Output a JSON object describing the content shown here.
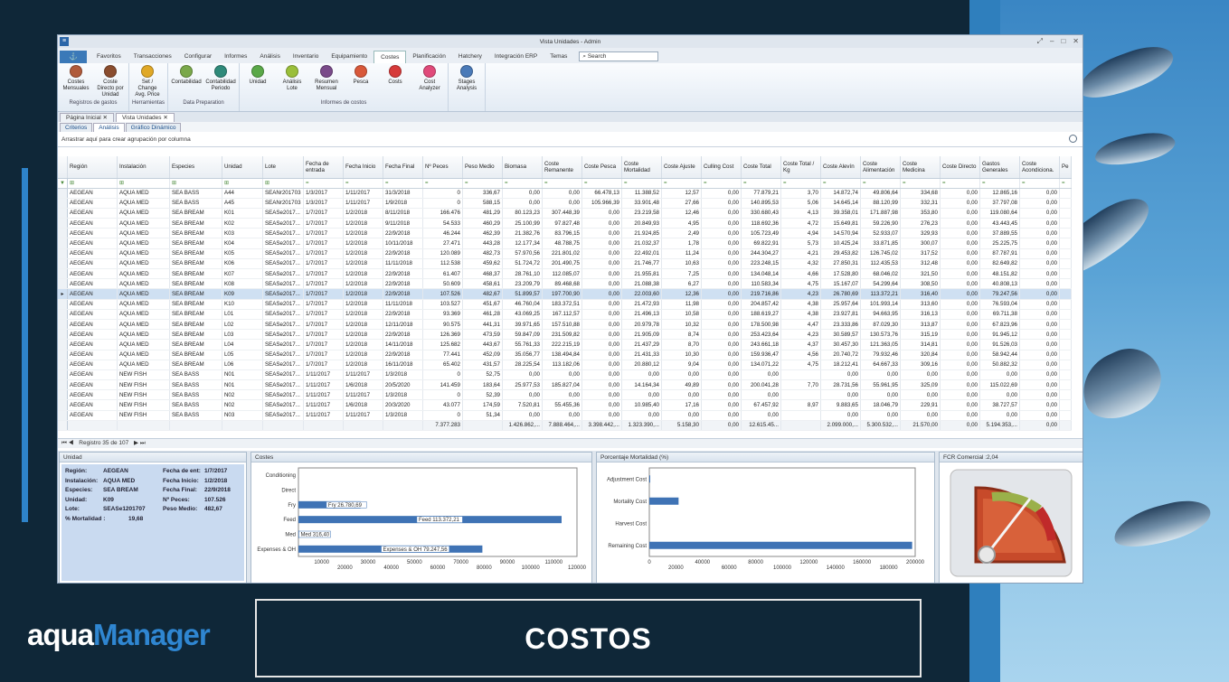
{
  "window": {
    "title": "Vista Unidades - Admin"
  },
  "menu": {
    "tabs": [
      "Favoritos",
      "Transacciones",
      "Configurar",
      "Informes",
      "Análisis",
      "Inventario",
      "Equipamiento",
      "Costes",
      "Planificación",
      "Hatchery",
      "Integración ERP",
      "Temas"
    ],
    "active": "Costes",
    "search_placeholder": "Search"
  },
  "ribbon": {
    "groups": [
      {
        "label": "Registros de gastos",
        "buttons": [
          {
            "label": "Costes Mensuales",
            "color": "#b05a3a"
          },
          {
            "label": "Coste Directo por Unidad",
            "color": "#8a4d2e"
          }
        ]
      },
      {
        "label": "Herramientas",
        "buttons": [
          {
            "label": "Set / Change Avg. Price",
            "color": "#e0a826"
          }
        ]
      },
      {
        "label": "Data Preparation",
        "buttons": [
          {
            "label": "Contabilidad",
            "color": "#7aa84a"
          },
          {
            "label": "Contabilidad Periodo",
            "color": "#2f8a7a"
          }
        ]
      },
      {
        "label": "Informes de costos",
        "buttons": [
          {
            "label": "Unidad",
            "color": "#5aa848"
          },
          {
            "label": "Análisis Lote",
            "color": "#9abf3a"
          },
          {
            "label": "Resumen Mensual",
            "color": "#7a4a8a"
          },
          {
            "label": "Pesca",
            "color": "#d8583a"
          },
          {
            "label": "Costs",
            "color": "#d63a3a"
          },
          {
            "label": "Cost Analyzer",
            "color": "#e04a7a"
          }
        ]
      },
      {
        "label": "",
        "buttons": [
          {
            "label": "Stages Analysis",
            "color": "#4a7ab8"
          }
        ]
      }
    ]
  },
  "doc_tabs": [
    "Página Inicial",
    "Vista Unidades"
  ],
  "sub_tabs": [
    "Criterios",
    "Análisis",
    "Gráfico Dinámico"
  ],
  "group_hint": "Arrastrar aquí para crear agrupación por columna",
  "grid": {
    "columns": [
      "Región",
      "Instalación",
      "Especies",
      "Unidad",
      "Lote",
      "Fecha de entrada",
      "Fecha Inicio",
      "Fecha Final",
      "Nº Peces",
      "Peso Medio",
      "Biomasa",
      "Coste Remanente",
      "Coste Pesca",
      "Coste Mortalidad",
      "Coste Ajuste",
      "Culling Cost",
      "Coste Total",
      "Coste Total / Kg",
      "Coste Alevín",
      "Coste Alimentación",
      "Coste Medicina",
      "Coste Directo",
      "Gastos Generales",
      "Coste Acondiciona.",
      "Pe"
    ],
    "rows": [
      [
        "AEGEAN",
        "AQUA MED",
        "SEA BASS",
        "A44",
        "SEANr201703",
        "1/3/2017",
        "1/11/2017",
        "31/3/2018",
        "0",
        "336,67",
        "0,00",
        "0,00",
        "66.478,13",
        "11.388,52",
        "12,57",
        "0,00",
        "77.879,21",
        "3,70",
        "14.872,74",
        "49.806,64",
        "334,68",
        "0,00",
        "12.865,16",
        "0,00"
      ],
      [
        "AEGEAN",
        "AQUA MED",
        "SEA BASS",
        "A45",
        "SEANr201703",
        "1/3/2017",
        "1/11/2017",
        "1/9/2018",
        "0",
        "588,15",
        "0,00",
        "0,00",
        "105.966,39",
        "33.901,48",
        "27,66",
        "0,00",
        "140.895,53",
        "5,06",
        "14.645,14",
        "88.120,99",
        "332,31",
        "0,00",
        "37.797,08",
        "0,00"
      ],
      [
        "AEGEAN",
        "AQUA MED",
        "SEA BREAM",
        "K01",
        "SEASe2017...",
        "1/7/2017",
        "1/2/2018",
        "8/11/2018",
        "166.476",
        "481,29",
        "80.123,23",
        "307.448,39",
        "0,00",
        "23.219,58",
        "12,46",
        "0,00",
        "330.680,43",
        "4,13",
        "39.358,01",
        "171.887,98",
        "353,80",
        "0,00",
        "119.080,64",
        "0,00"
      ],
      [
        "AEGEAN",
        "AQUA MED",
        "SEA BREAM",
        "K02",
        "SEASe2017...",
        "1/7/2017",
        "1/2/2018",
        "9/11/2018",
        "54.533",
        "460,29",
        "25.100,99",
        "97.827,48",
        "0,00",
        "20.849,93",
        "4,95",
        "0,00",
        "118.692,36",
        "4,72",
        "15.649,81",
        "59.226,90",
        "276,23",
        "0,00",
        "43.443,45",
        "0,00"
      ],
      [
        "AEGEAN",
        "AQUA MED",
        "SEA BREAM",
        "K03",
        "SEASe2017...",
        "1/7/2017",
        "1/2/2018",
        "22/9/2018",
        "46.244",
        "462,39",
        "21.382,76",
        "83.796,15",
        "0,00",
        "21.924,85",
        "2,49",
        "0,00",
        "105.723,49",
        "4,94",
        "14.570,94",
        "52.933,07",
        "329,93",
        "0,00",
        "37.889,55",
        "0,00"
      ],
      [
        "AEGEAN",
        "AQUA MED",
        "SEA BREAM",
        "K04",
        "SEASe2017...",
        "1/7/2017",
        "1/2/2018",
        "10/11/2018",
        "27.471",
        "443,28",
        "12.177,34",
        "48.788,75",
        "0,00",
        "21.032,37",
        "1,78",
        "0,00",
        "69.822,91",
        "5,73",
        "10.425,24",
        "33.871,85",
        "300,07",
        "0,00",
        "25.225,75",
        "0,00"
      ],
      [
        "AEGEAN",
        "AQUA MED",
        "SEA BREAM",
        "K05",
        "SEASe2017...",
        "1/7/2017",
        "1/2/2018",
        "22/9/2018",
        "120.089",
        "482,73",
        "57.970,56",
        "221.801,02",
        "0,00",
        "22.492,01",
        "11,24",
        "0,00",
        "244.304,27",
        "4,21",
        "29.453,82",
        "126.745,02",
        "317,52",
        "0,00",
        "87.787,91",
        "0,00"
      ],
      [
        "AEGEAN",
        "AQUA MED",
        "SEA BREAM",
        "K06",
        "SEASe2017...",
        "1/7/2017",
        "1/2/2018",
        "11/11/2018",
        "112.538",
        "459,62",
        "51.724,72",
        "201.490,75",
        "0,00",
        "21.746,77",
        "10,63",
        "0,00",
        "223.248,15",
        "4,32",
        "27.850,31",
        "112.435,53",
        "312,48",
        "0,00",
        "82.649,82",
        "0,00"
      ],
      [
        "AEGEAN",
        "AQUA MED",
        "SEA BREAM",
        "K07",
        "SEASe2017...",
        "1/7/2017",
        "1/2/2018",
        "22/9/2018",
        "61.407",
        "468,37",
        "28.761,10",
        "112.085,07",
        "0,00",
        "21.955,81",
        "7,25",
        "0,00",
        "134.048,14",
        "4,66",
        "17.528,80",
        "68.046,02",
        "321,50",
        "0,00",
        "48.151,82",
        "0,00"
      ],
      [
        "AEGEAN",
        "AQUA MED",
        "SEA BREAM",
        "K08",
        "SEASe2017...",
        "1/7/2017",
        "1/2/2018",
        "22/9/2018",
        "50.609",
        "458,61",
        "23.209,79",
        "89.468,68",
        "0,00",
        "21.088,38",
        "6,27",
        "0,00",
        "110.583,34",
        "4,75",
        "15.167,07",
        "54.299,64",
        "308,50",
        "0,00",
        "40.808,13",
        "0,00"
      ],
      [
        "AEGEAN",
        "AQUA MED",
        "SEA BREAM",
        "K09",
        "SEASe2017...",
        "1/7/2017",
        "1/2/2018",
        "22/9/2018",
        "107.526",
        "482,67",
        "51.899,57",
        "197.700,90",
        "0,00",
        "22.003,60",
        "12,36",
        "0,00",
        "219.716,86",
        "4,23",
        "26.780,69",
        "113.372,21",
        "316,40",
        "0,00",
        "79.247,56",
        "0,00"
      ],
      [
        "AEGEAN",
        "AQUA MED",
        "SEA BREAM",
        "K10",
        "SEASe2017...",
        "1/7/2017",
        "1/2/2018",
        "11/11/2018",
        "103.527",
        "451,67",
        "46.760,04",
        "183.372,51",
        "0,00",
        "21.472,93",
        "11,98",
        "0,00",
        "204.857,42",
        "4,38",
        "25.957,64",
        "101.993,14",
        "313,60",
        "0,00",
        "76.593,04",
        "0,00"
      ],
      [
        "AEGEAN",
        "AQUA MED",
        "SEA BREAM",
        "L01",
        "SEASe2017...",
        "1/7/2017",
        "1/2/2018",
        "22/9/2018",
        "93.369",
        "461,28",
        "43.069,25",
        "167.112,57",
        "0,00",
        "21.496,13",
        "10,58",
        "0,00",
        "188.619,27",
        "4,38",
        "23.927,81",
        "94.663,95",
        "316,13",
        "0,00",
        "69.711,38",
        "0,00"
      ],
      [
        "AEGEAN",
        "AQUA MED",
        "SEA BREAM",
        "L02",
        "SEASe2017...",
        "1/7/2017",
        "1/2/2018",
        "12/11/2018",
        "90.575",
        "441,31",
        "39.971,65",
        "157.510,88",
        "0,00",
        "20.979,78",
        "10,32",
        "0,00",
        "178.500,98",
        "4,47",
        "23.333,86",
        "87.029,30",
        "313,87",
        "0,00",
        "67.823,96",
        "0,00"
      ],
      [
        "AEGEAN",
        "AQUA MED",
        "SEA BREAM",
        "L03",
        "SEASe2017...",
        "1/7/2017",
        "1/2/2018",
        "22/9/2018",
        "126.369",
        "473,59",
        "59.847,09",
        "231.509,82",
        "0,00",
        "21.905,09",
        "8,74",
        "0,00",
        "253.423,64",
        "4,23",
        "30.589,57",
        "130.573,76",
        "315,19",
        "0,00",
        "91.945,12",
        "0,00"
      ],
      [
        "AEGEAN",
        "AQUA MED",
        "SEA BREAM",
        "L04",
        "SEASe2017...",
        "1/7/2017",
        "1/2/2018",
        "14/11/2018",
        "125.682",
        "443,67",
        "55.761,33",
        "222.215,19",
        "0,00",
        "21.437,29",
        "8,70",
        "0,00",
        "243.661,18",
        "4,37",
        "30.457,30",
        "121.363,05",
        "314,81",
        "0,00",
        "91.526,03",
        "0,00"
      ],
      [
        "AEGEAN",
        "AQUA MED",
        "SEA BREAM",
        "L05",
        "SEASe2017...",
        "1/7/2017",
        "1/2/2018",
        "22/9/2018",
        "77.441",
        "452,09",
        "35.056,77",
        "138.494,84",
        "0,00",
        "21.431,33",
        "10,30",
        "0,00",
        "159.936,47",
        "4,56",
        "20.740,72",
        "79.932,46",
        "320,84",
        "0,00",
        "58.942,44",
        "0,00"
      ],
      [
        "AEGEAN",
        "AQUA MED",
        "SEA BREAM",
        "L06",
        "SEASe2017...",
        "1/7/2017",
        "1/2/2018",
        "16/11/2018",
        "65.402",
        "431,57",
        "28.225,54",
        "113.182,06",
        "0,00",
        "20.880,12",
        "9,04",
        "0,00",
        "134.071,22",
        "4,75",
        "18.212,41",
        "64.667,33",
        "309,16",
        "0,00",
        "50.882,32",
        "0,00"
      ],
      [
        "AEGEAN",
        "NEW FISH",
        "SEA BASS",
        "N01",
        "SEASe2017...",
        "1/11/2017",
        "1/11/2017",
        "1/3/2018",
        "0",
        "52,75",
        "0,00",
        "0,00",
        "0,00",
        "0,00",
        "0,00",
        "0,00",
        "0,00",
        "",
        "0,00",
        "0,00",
        "0,00",
        "0,00",
        "0,00",
        "0,00"
      ],
      [
        "AEGEAN",
        "NEW FISH",
        "SEA BASS",
        "N01",
        "SEASe2017...",
        "1/11/2017",
        "1/6/2018",
        "20/5/2020",
        "141.459",
        "183,64",
        "25.977,53",
        "185.827,04",
        "0,00",
        "14.164,34",
        "49,89",
        "0,00",
        "200.041,28",
        "7,70",
        "28.731,56",
        "55.961,95",
        "325,09",
        "0,00",
        "115.022,69",
        "0,00"
      ],
      [
        "AEGEAN",
        "NEW FISH",
        "SEA BASS",
        "N02",
        "SEASe2017...",
        "1/11/2017",
        "1/11/2017",
        "1/3/2018",
        "0",
        "52,39",
        "0,00",
        "0,00",
        "0,00",
        "0,00",
        "0,00",
        "0,00",
        "0,00",
        "",
        "0,00",
        "0,00",
        "0,00",
        "0,00",
        "0,00",
        "0,00"
      ],
      [
        "AEGEAN",
        "NEW FISH",
        "SEA BASS",
        "N02",
        "SEASe2017...",
        "1/11/2017",
        "1/6/2018",
        "20/3/2020",
        "43.077",
        "174,59",
        "7.520,81",
        "55.455,36",
        "0,00",
        "10.985,40",
        "17,16",
        "0,00",
        "67.457,92",
        "8,97",
        "9.883,65",
        "18.046,79",
        "229,91",
        "0,00",
        "38.727,57",
        "0,00"
      ],
      [
        "AEGEAN",
        "NEW FISH",
        "SEA BASS",
        "N03",
        "SEASe2017...",
        "1/11/2017",
        "1/11/2017",
        "1/3/2018",
        "0",
        "51,34",
        "0,00",
        "0,00",
        "0,00",
        "0,00",
        "0,00",
        "0,00",
        "0,00",
        "",
        "0,00",
        "0,00",
        "0,00",
        "0,00",
        "0,00",
        "0,00"
      ]
    ],
    "selected_row": 10,
    "totals": [
      "",
      "",
      "",
      "",
      "",
      "",
      "",
      "",
      "7.377.283",
      "",
      "1.426.862,...",
      "7.888.464,...",
      "3.398.442,...",
      "1.323.390,...",
      "5.158,30",
      "0,00",
      "12.615.45...",
      "",
      "2.099.000,...",
      "5.300.532,...",
      "21.570,00",
      "0,00",
      "5.194.353,...",
      "0,00"
    ]
  },
  "navigator": {
    "record_text": "Registro 35 de 107"
  },
  "unit_panel": {
    "title": "Unidad",
    "fields": [
      {
        "label": "Región:",
        "value": "AEGEAN"
      },
      {
        "label": "Instalación:",
        "value": "AQUA MED"
      },
      {
        "label": "Especies:",
        "value": "SEA BREAM"
      },
      {
        "label": "Unidad:",
        "value": "K09"
      },
      {
        "label": "Lote:",
        "value": "SEASe1201707"
      },
      {
        "label": "% Mortalidad :",
        "value": "19,68"
      }
    ],
    "fields_right": [
      {
        "label": "Fecha de ent:",
        "value": "1/7/2017"
      },
      {
        "label": "Fecha Inicio:",
        "value": "1/2/2018"
      },
      {
        "label": "Fecha Final:",
        "value": "22/9/2018"
      },
      {
        "label": "Nº Peces:",
        "value": "107.526"
      },
      {
        "label": "Peso Medio:",
        "value": "482,67"
      }
    ]
  },
  "chart_data": [
    {
      "type": "bar",
      "title": "Costes",
      "orientation": "horizontal",
      "categories": [
        "Conditioning",
        "Direct",
        "Fry",
        "Feed",
        "Med",
        "Expenses & OH"
      ],
      "values": [
        0,
        0,
        26780.69,
        113372.21,
        316.4,
        79247.56
      ],
      "data_labels": [
        "",
        "",
        "Fry 26.780,69",
        "Feed 113.372,21",
        "Med 316,40",
        "Expenses & OH 79.247,56"
      ],
      "xlim": [
        0,
        120000
      ],
      "xticks": [
        "10000",
        "20000",
        "30000",
        "40000",
        "50000",
        "60000",
        "70000",
        "80000",
        "90000",
        "100000",
        "110000",
        "120000"
      ]
    },
    {
      "type": "bar",
      "title": "Porcentaje Mortalidad (%)",
      "orientation": "horizontal",
      "categories": [
        "Adjustment Cost",
        "Mortality Cost",
        "Harvest Cost",
        "Remaining Cost"
      ],
      "values": [
        12.36,
        22003.6,
        0,
        197700.9
      ],
      "xlim": [
        0,
        200000
      ],
      "xticks": [
        "0",
        "20000",
        "40000",
        "60000",
        "80000",
        "100000",
        "120000",
        "140000",
        "160000",
        "180000",
        "200000"
      ]
    }
  ],
  "gauge": {
    "title": "FCR Comercial :2,04",
    "value": 2.04
  },
  "caption": {
    "text": "COSTOS"
  },
  "logo": {
    "part1": "aqua",
    "part2": "Manager"
  }
}
